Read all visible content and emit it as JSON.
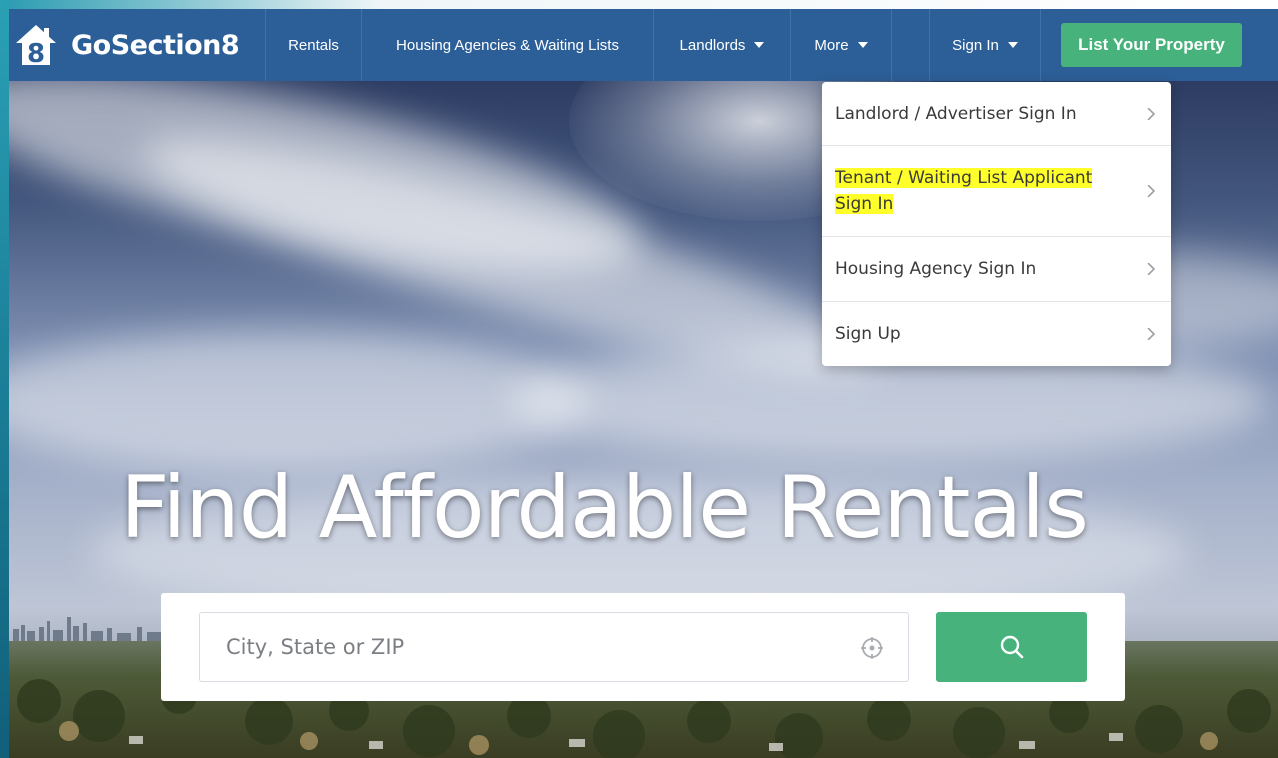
{
  "brand": {
    "logo_glyph": "8",
    "name": "GoSection8",
    "icon": "house-8-logo-icon"
  },
  "nav": {
    "rentals": "Rentals",
    "housing_agencies": "Housing Agencies & Waiting Lists",
    "landlords": "Landlords",
    "more": "More",
    "sign_in": "Sign In",
    "list_property": "List Your Property"
  },
  "dropdown": {
    "items": [
      {
        "label": "Landlord / Advertiser Sign In",
        "highlighted": false
      },
      {
        "label_line1": "Tenant / Waiting List Applicant",
        "label_line2": "Sign In",
        "highlighted": true
      },
      {
        "label": "Housing Agency Sign In",
        "highlighted": false
      },
      {
        "label": "Sign Up",
        "highlighted": false
      }
    ]
  },
  "hero": {
    "title": "Find Affordable Rentals"
  },
  "search": {
    "placeholder": "City, State or ZIP",
    "locate_icon": "crosshair-icon",
    "button_icon": "search-icon"
  },
  "colors": {
    "navbar": "#2c5f97",
    "accent_green": "#47b27c",
    "highlight": "#ffff2a"
  }
}
